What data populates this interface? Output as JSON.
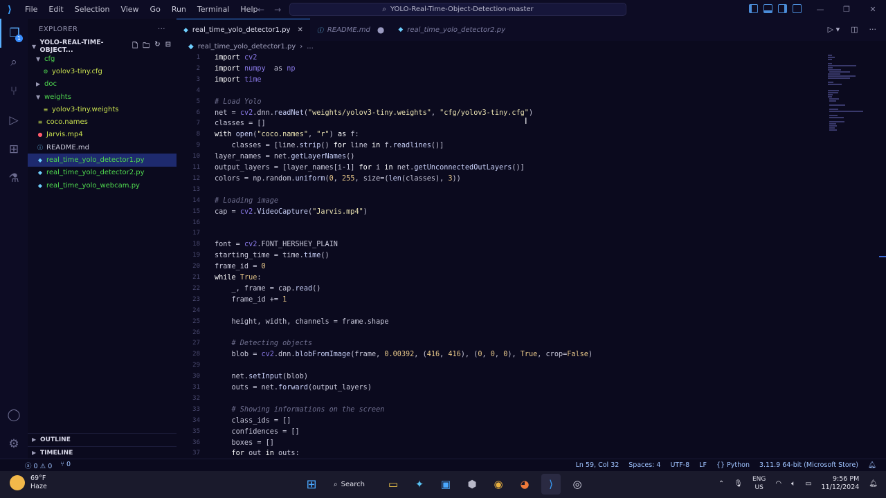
{
  "titlebar": {
    "menu": [
      "File",
      "Edit",
      "Selection",
      "View",
      "Go",
      "Run",
      "Terminal",
      "Help"
    ],
    "command_center": "YOLO-Real-Time-Object-Detection-master"
  },
  "activity": {
    "badge": "1"
  },
  "sidebar": {
    "header": "EXPLORER",
    "header_more": "···",
    "root": "YOLO-REAL-TIME-OBJECT...",
    "tree": [
      {
        "label": "cfg",
        "type": "folder",
        "open": true,
        "indent": 0
      },
      {
        "label": "yolov3-tiny.cfg",
        "type": "gear",
        "indent": 1
      },
      {
        "label": "doc",
        "type": "folder",
        "open": false,
        "indent": 0
      },
      {
        "label": "weights",
        "type": "folder",
        "open": true,
        "indent": 0
      },
      {
        "label": "yolov3-tiny.weights",
        "type": "lines",
        "indent": 1
      },
      {
        "label": "coco.names",
        "type": "lines",
        "indent": 0
      },
      {
        "label": "Jarvis.mp4",
        "type": "video",
        "indent": 0
      },
      {
        "label": "README.md",
        "type": "info",
        "indent": 0
      },
      {
        "label": "real_time_yolo_detector1.py",
        "type": "python",
        "indent": 0,
        "selected": true
      },
      {
        "label": "real_time_yolo_detector2.py",
        "type": "python",
        "indent": 0
      },
      {
        "label": "real_time_yolo_webcam.py",
        "type": "python",
        "indent": 0
      }
    ],
    "outline": "OUTLINE",
    "timeline": "TIMELINE"
  },
  "tabs": [
    {
      "label": "real_time_yolo_detector1.py",
      "active": true
    },
    {
      "label": "README.md",
      "active": false,
      "modified": true
    },
    {
      "label": "real_time_yolo_detector2.py",
      "active": false
    }
  ],
  "breadcrumb": {
    "file": "real_time_yolo_detector1.py",
    "more": "..."
  },
  "editor": {
    "lines": [
      {
        "n": "1",
        "t": [
          [
            "k-kw",
            "import "
          ],
          [
            "k-mod",
            "cv2"
          ]
        ]
      },
      {
        "n": "2",
        "t": [
          [
            "k-kw",
            "import "
          ],
          [
            "k-mod",
            "numpy"
          ],
          [
            "",
            "  as "
          ],
          [
            "k-mod",
            "np"
          ]
        ]
      },
      {
        "n": "3",
        "t": [
          [
            "k-kw",
            "import "
          ],
          [
            "k-mod",
            "time"
          ]
        ]
      },
      {
        "n": "4",
        "t": []
      },
      {
        "n": "5",
        "t": [
          [
            "k-com",
            "# Load Yolo"
          ]
        ]
      },
      {
        "n": "6",
        "t": [
          [
            "",
            "net = "
          ],
          [
            "k-mod",
            "cv2"
          ],
          [
            "",
            ".dnn."
          ],
          [
            "k-fn",
            "readNet"
          ],
          [
            "",
            "("
          ],
          [
            "k-str",
            "\"weights/yolov3-tiny.weights\""
          ],
          [
            "",
            ", "
          ],
          [
            "k-str",
            "\"cfg/yolov3-tiny.cfg\""
          ],
          [
            "",
            ")"
          ]
        ]
      },
      {
        "n": "7",
        "t": [
          [
            "",
            "classes = []"
          ]
        ]
      },
      {
        "n": "8",
        "t": [
          [
            "k-kw",
            "with "
          ],
          [
            "k-fn",
            "open"
          ],
          [
            "",
            "("
          ],
          [
            "k-str",
            "\"coco.names\""
          ],
          [
            "",
            ", "
          ],
          [
            "k-str",
            "\"r\""
          ],
          [
            "",
            ") "
          ],
          [
            "k-kw",
            "as "
          ],
          [
            "",
            "f:"
          ]
        ]
      },
      {
        "n": "9",
        "t": [
          [
            "",
            "    classes = [line."
          ],
          [
            "k-fn",
            "strip"
          ],
          [
            "",
            "() "
          ],
          [
            "k-kw",
            "for "
          ],
          [
            "",
            "line "
          ],
          [
            "k-kw",
            "in "
          ],
          [
            "",
            "f."
          ],
          [
            "k-fn",
            "readlines"
          ],
          [
            "",
            "()]"
          ]
        ]
      },
      {
        "n": "10",
        "t": [
          [
            "",
            "layer_names = net."
          ],
          [
            "k-fn",
            "getLayerNames"
          ],
          [
            "",
            "()"
          ]
        ]
      },
      {
        "n": "11",
        "t": [
          [
            "",
            "output_layers = [layer_names[i-1] "
          ],
          [
            "k-kw",
            "for "
          ],
          [
            "",
            "i "
          ],
          [
            "k-kw",
            "in "
          ],
          [
            "",
            "net."
          ],
          [
            "k-fn",
            "getUnconnectedOutLayers"
          ],
          [
            "",
            "()]"
          ]
        ]
      },
      {
        "n": "12",
        "t": [
          [
            "",
            "colors = np.random."
          ],
          [
            "k-fn",
            "uniform"
          ],
          [
            "",
            "("
          ],
          [
            "k-num",
            "0"
          ],
          [
            "",
            ", "
          ],
          [
            "k-num",
            "255"
          ],
          [
            "",
            ", size=("
          ],
          [
            "k-fn",
            "len"
          ],
          [
            "",
            "(classes), "
          ],
          [
            "k-num",
            "3"
          ],
          [
            "",
            "))"
          ]
        ]
      },
      {
        "n": "13",
        "t": []
      },
      {
        "n": "14",
        "t": [
          [
            "k-com",
            "# Loading image"
          ]
        ]
      },
      {
        "n": "15",
        "t": [
          [
            "",
            "cap = "
          ],
          [
            "k-mod",
            "cv2"
          ],
          [
            "",
            "."
          ],
          [
            "k-fn",
            "VideoCapture"
          ],
          [
            "",
            "("
          ],
          [
            "k-str",
            "\"Jarvis.mp4\""
          ],
          [
            "",
            ")"
          ]
        ]
      },
      {
        "n": "16",
        "t": []
      },
      {
        "n": "17",
        "t": []
      },
      {
        "n": "18",
        "t": [
          [
            "",
            "font = "
          ],
          [
            "k-mod",
            "cv2"
          ],
          [
            "",
            ".FONT_HERSHEY_PLAIN"
          ]
        ]
      },
      {
        "n": "19",
        "t": [
          [
            "",
            "starting_time = time."
          ],
          [
            "k-fn",
            "time"
          ],
          [
            "",
            "()"
          ]
        ]
      },
      {
        "n": "20",
        "t": [
          [
            "",
            "frame_id = "
          ],
          [
            "k-num",
            "0"
          ]
        ]
      },
      {
        "n": "21",
        "t": [
          [
            "k-kw",
            "while "
          ],
          [
            "k-num",
            "True"
          ],
          [
            "",
            ":"
          ]
        ]
      },
      {
        "n": "22",
        "t": [
          [
            "",
            "    _, frame = cap."
          ],
          [
            "k-fn",
            "read"
          ],
          [
            "",
            "()"
          ]
        ]
      },
      {
        "n": "23",
        "t": [
          [
            "",
            "    frame_id += "
          ],
          [
            "k-num",
            "1"
          ]
        ]
      },
      {
        "n": "24",
        "t": []
      },
      {
        "n": "25",
        "t": [
          [
            "",
            "    height, width, channels = frame.shape"
          ]
        ]
      },
      {
        "n": "26",
        "t": []
      },
      {
        "n": "27",
        "t": [
          [
            "k-com",
            "    # Detecting objects"
          ]
        ]
      },
      {
        "n": "28",
        "t": [
          [
            "",
            "    blob = "
          ],
          [
            "k-mod",
            "cv2"
          ],
          [
            "",
            ".dnn."
          ],
          [
            "k-fn",
            "blobFromImage"
          ],
          [
            "",
            "(frame, "
          ],
          [
            "k-num",
            "0.00392"
          ],
          [
            "",
            ", ("
          ],
          [
            "k-num",
            "416"
          ],
          [
            "",
            ", "
          ],
          [
            "k-num",
            "416"
          ],
          [
            "",
            "), ("
          ],
          [
            "k-num",
            "0"
          ],
          [
            "",
            ", "
          ],
          [
            "k-num",
            "0"
          ],
          [
            "",
            ", "
          ],
          [
            "k-num",
            "0"
          ],
          [
            "",
            "), "
          ],
          [
            "k-num",
            "True"
          ],
          [
            "",
            ", crop="
          ],
          [
            "k-num",
            "False"
          ],
          [
            "",
            ")"
          ]
        ]
      },
      {
        "n": "29",
        "t": []
      },
      {
        "n": "30",
        "t": [
          [
            "",
            "    net."
          ],
          [
            "k-fn",
            "setInput"
          ],
          [
            "",
            "(blob)"
          ]
        ]
      },
      {
        "n": "31",
        "t": [
          [
            "",
            "    outs = net."
          ],
          [
            "k-fn",
            "forward"
          ],
          [
            "",
            "(output_layers)"
          ]
        ]
      },
      {
        "n": "32",
        "t": []
      },
      {
        "n": "33",
        "t": [
          [
            "k-com",
            "    # Showing informations on the screen"
          ]
        ]
      },
      {
        "n": "34",
        "t": [
          [
            "",
            "    class_ids = []"
          ]
        ]
      },
      {
        "n": "35",
        "t": [
          [
            "",
            "    confidences = []"
          ]
        ]
      },
      {
        "n": "36",
        "t": [
          [
            "",
            "    boxes = []"
          ]
        ]
      },
      {
        "n": "37",
        "t": [
          [
            "k-kw",
            "    for "
          ],
          [
            "",
            "out "
          ],
          [
            "k-kw",
            "in "
          ],
          [
            "",
            "outs:"
          ]
        ]
      }
    ]
  },
  "statusbar": {
    "errors": "0",
    "warnings": "0",
    "ports": "0",
    "position": "Ln 59, Col 32",
    "spaces": "Spaces: 4",
    "encoding": "UTF-8",
    "eol": "LF",
    "language": "Python",
    "interpreter": "3.11.9 64-bit (Microsoft Store)"
  },
  "taskbar": {
    "weather_temp": "69°F",
    "weather_desc": "Haze",
    "search": "Search",
    "lang_1": "ENG",
    "lang_2": "US",
    "time": "9:56 PM",
    "date": "11/12/2024"
  }
}
